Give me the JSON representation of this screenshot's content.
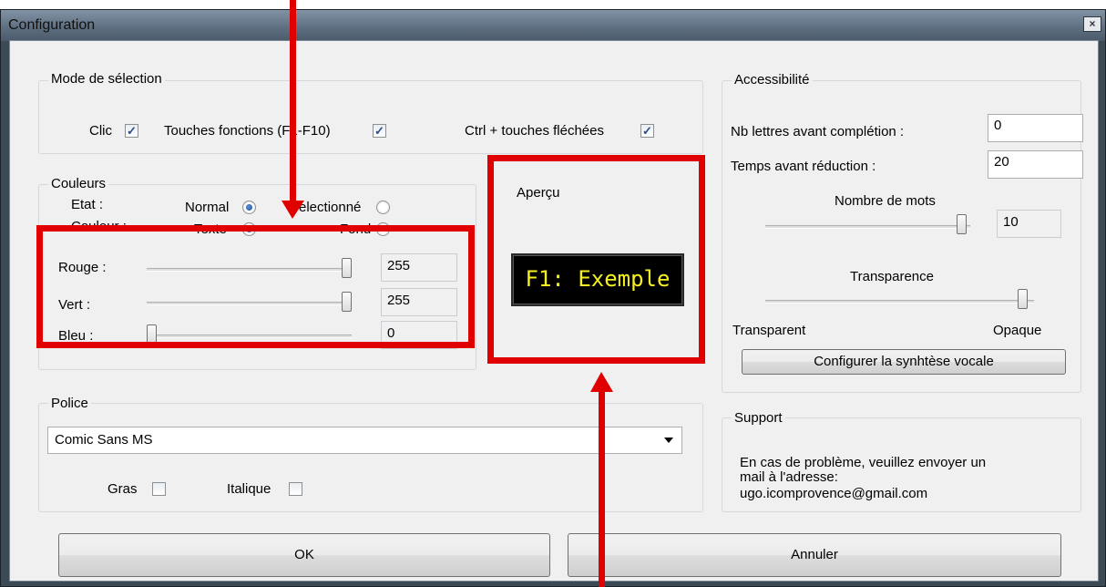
{
  "window": {
    "title": "Configuration",
    "close_glyph": "×"
  },
  "selection_mode": {
    "title": "Mode de sélection",
    "click": {
      "label": "Clic",
      "checked": true
    },
    "function_keys": {
      "label": "Touches fonctions (F1-F10)",
      "checked": true
    },
    "ctrl_arrows": {
      "label": "Ctrl + touches fléchées",
      "checked": true
    }
  },
  "colors": {
    "title": "Couleurs",
    "state_label": "Etat :",
    "state_normal": "Normal",
    "state_selected": "Selectionné",
    "color_label": "Couleur :",
    "color_text": "Texte",
    "color_background": "Fond",
    "red": {
      "label": "Rouge :",
      "value": "255",
      "level": 1.0
    },
    "green": {
      "label": "Vert :",
      "value": "255",
      "level": 1.0
    },
    "blue": {
      "label": "Bleu :",
      "value": "0",
      "level": 0.0
    }
  },
  "preview": {
    "title": "Aperçu",
    "sample": "F1: Exemple",
    "text_color": "#f5f020"
  },
  "accessibility": {
    "title": "Accessibilité",
    "letters_label": "Nb lettres avant complétion :",
    "letters_value": "0",
    "reduction_label": "Temps avant réduction :",
    "reduction_value": "20",
    "words_title": "Nombre de mots",
    "words_value": "10",
    "transparency_title": "Transparence",
    "transparent_label": "Transparent",
    "opaque_label": "Opaque",
    "speech_button": "Configurer la synhtèse vocale"
  },
  "font": {
    "title": "Police",
    "selected": "Comic Sans MS",
    "bold": {
      "label": "Gras",
      "checked": false
    },
    "italic": {
      "label": "Italique",
      "checked": false
    }
  },
  "support": {
    "title": "Support",
    "line1": "En cas de problème, veuillez envoyer un",
    "line2": "mail à l'adresse:",
    "line3": "ugo.icomprovence@gmail.com"
  },
  "buttons": {
    "ok": "OK",
    "cancel": "Annuler"
  },
  "annotation_color": "#e00000"
}
